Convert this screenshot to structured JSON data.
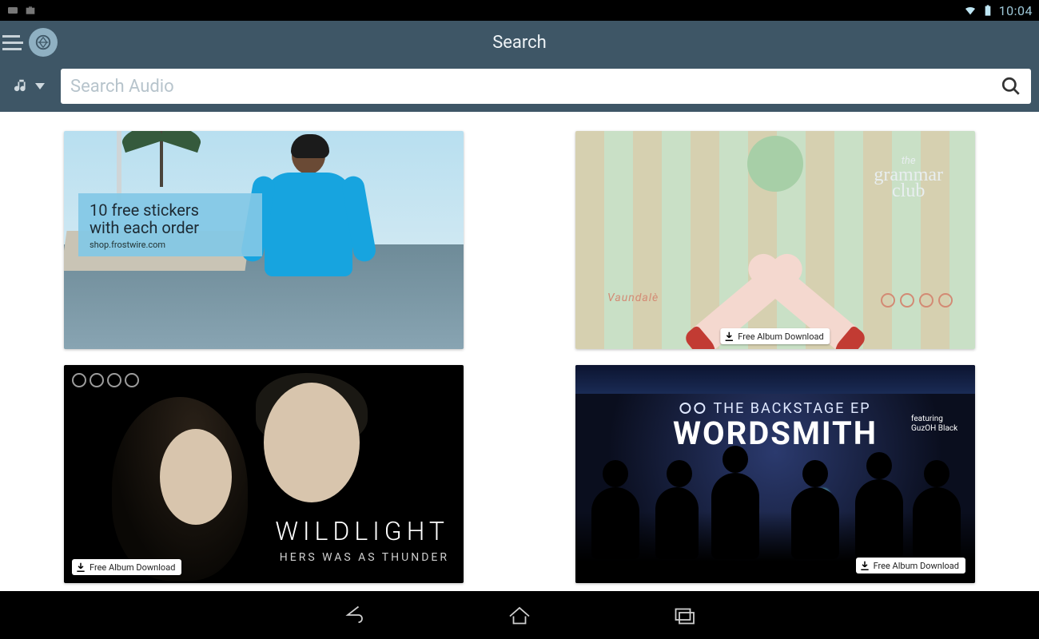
{
  "status": {
    "time": "10:04"
  },
  "header": {
    "title": "Search"
  },
  "search": {
    "placeholder": "Search Audio",
    "category_icon": "music-note-icon"
  },
  "cards": [
    {
      "kind": "promo",
      "line1": "10 free stickers",
      "line2": "with each order",
      "subtext": "shop.frostwire.com"
    },
    {
      "kind": "album",
      "brand_small": "the",
      "brand_big1": "grammar",
      "brand_big2": "club",
      "left_word": "Vaundalè",
      "download_label": "Free Album Download"
    },
    {
      "kind": "album",
      "title": "WILDLIGHT",
      "subtitle": "HERS WAS AS THUNDER",
      "download_label": "Free Album Download"
    },
    {
      "kind": "album",
      "overline": "THE BACKSTAGE EP",
      "title": "WORDSMITH",
      "featuring_label": "featuring",
      "featuring_name": "GuzOH Black",
      "download_label": "Free Album Download"
    }
  ]
}
